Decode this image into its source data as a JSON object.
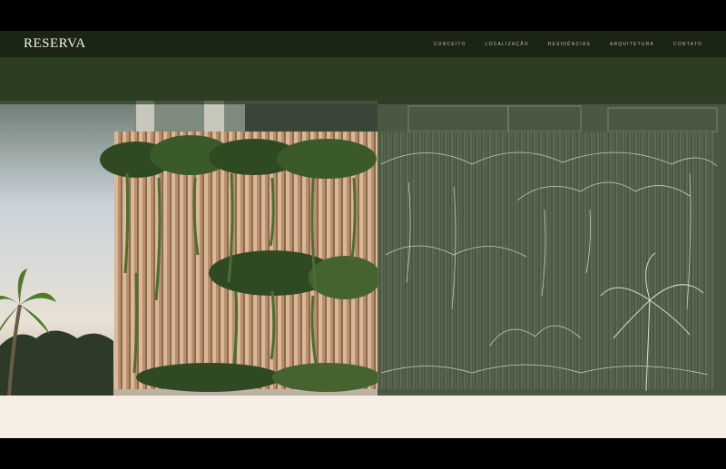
{
  "header": {
    "logo": "RESERVA",
    "nav": [
      {
        "id": "conceito",
        "label": "CONCEITO"
      },
      {
        "id": "localizacao",
        "label": "LOCALIZAÇÃO"
      },
      {
        "id": "residencias",
        "label": "RESIDÊNCIAS"
      },
      {
        "id": "arquitetura",
        "label": "ARQUITETURA"
      },
      {
        "id": "contato",
        "label": "CONTATO"
      }
    ]
  },
  "colors": {
    "nav_bg": "#1b2516",
    "band_bg": "#2c3d22",
    "sketch_bg": "#4a5741",
    "cream": "#f4eee3",
    "logo": "#f3efe4"
  },
  "hero": {
    "icons": [
      "facade-photo-image",
      "facade-sketch-image",
      "palm-tree-icon"
    ]
  }
}
